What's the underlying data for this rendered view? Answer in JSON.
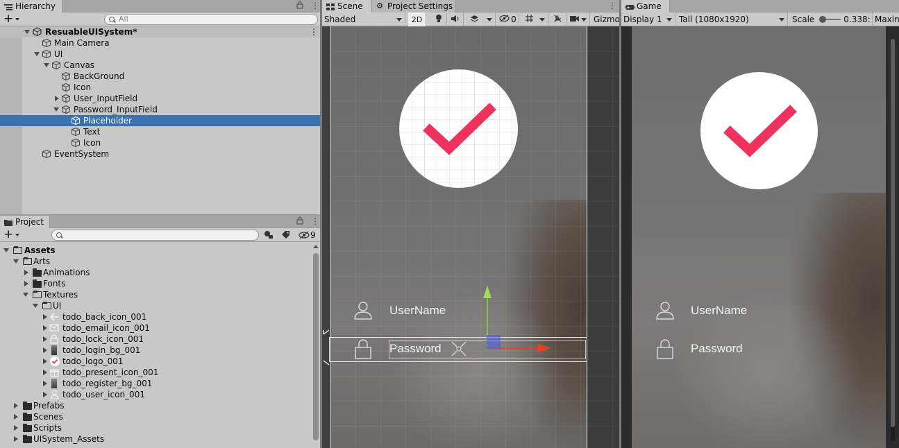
{
  "hierarchy": {
    "tab_label": "Hierarchy",
    "search_placeholder": "All",
    "scene_name": "ResuableUISystem*",
    "items": [
      {
        "label": "Main Camera"
      },
      {
        "label": "UI"
      },
      {
        "label": "Canvas"
      },
      {
        "label": "BackGround"
      },
      {
        "label": "Icon"
      },
      {
        "label": "User_InputField"
      },
      {
        "label": "Password_InputField"
      },
      {
        "label": "Placeholder"
      },
      {
        "label": "Text"
      },
      {
        "label": "Icon"
      },
      {
        "label": "EventSystem"
      }
    ]
  },
  "project": {
    "tab_label": "Project",
    "hidden_count": "9",
    "items": [
      {
        "label": "Assets"
      },
      {
        "label": "Arts"
      },
      {
        "label": "Animations"
      },
      {
        "label": "Fonts"
      },
      {
        "label": "Textures"
      },
      {
        "label": "UI"
      },
      {
        "label": "todo_back_icon_001"
      },
      {
        "label": "todo_email_icon_001"
      },
      {
        "label": "todo_lock_icon_001"
      },
      {
        "label": "todo_login_bg_001"
      },
      {
        "label": "todo_logo_001"
      },
      {
        "label": "todo_present_icon_001"
      },
      {
        "label": "todo_register_bg_001"
      },
      {
        "label": "todo_user_icon_001"
      },
      {
        "label": "Prefabs"
      },
      {
        "label": "Scenes"
      },
      {
        "label": "Scripts"
      },
      {
        "label": "UISystem_Assets"
      }
    ]
  },
  "scene": {
    "tab_label": "Scene",
    "tab2_label": "Project Settings",
    "shading_mode": "Shaded",
    "mode_2d": "2D",
    "hidden_count": "0",
    "gizmos_label": "Gizmo",
    "username_label": "UserName",
    "password_label": "Password"
  },
  "game": {
    "tab_label": "Game",
    "display": "Display 1",
    "resolution": "Tall (1080x1920)",
    "scale_label": "Scale",
    "scale_value": "0.338:",
    "maximize_label": "Maxin",
    "username_label": "UserName",
    "password_label": "Password"
  },
  "colors": {
    "selection": "#3a72b0",
    "accent_check": "#f0325f",
    "panel_bg": "#c8c8c8"
  }
}
